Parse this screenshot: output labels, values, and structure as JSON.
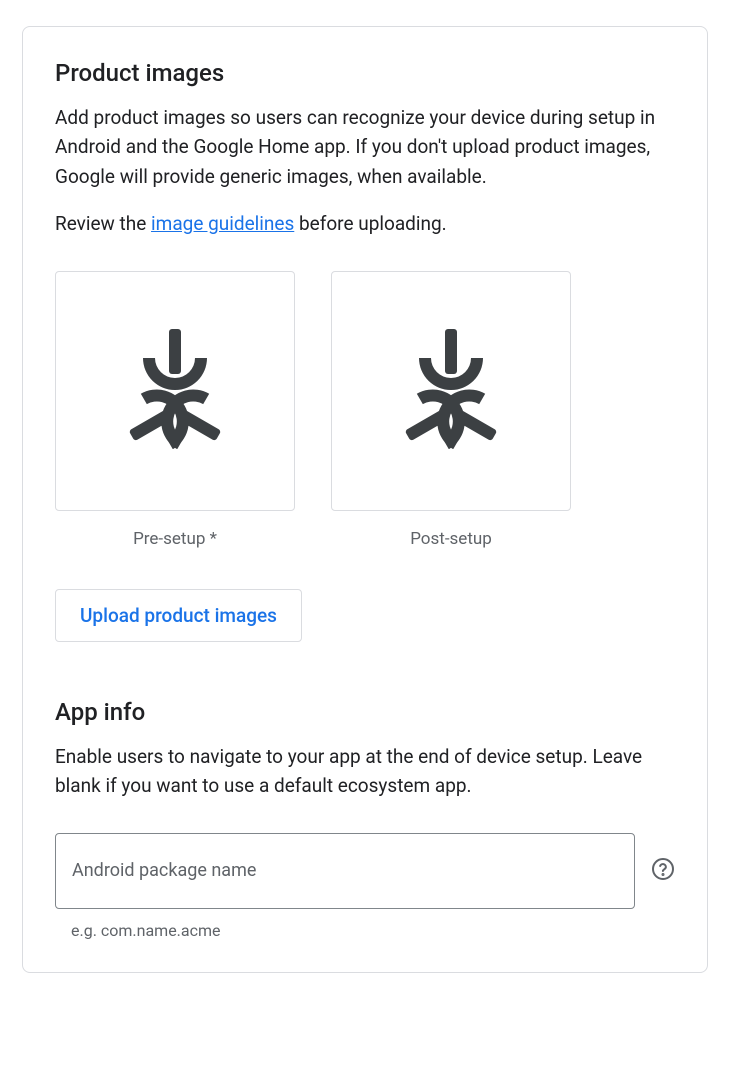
{
  "productImages": {
    "heading": "Product images",
    "description": "Add product images so users can recognize your device during setup in Android and the Google Home app. If you don't upload product images, Google will provide generic images, when available.",
    "reviewPrefix": "Review the ",
    "guidelinesLink": "image guidelines",
    "reviewSuffix": " before uploading.",
    "items": [
      {
        "caption": "Pre-setup *"
      },
      {
        "caption": "Post-setup"
      }
    ],
    "uploadButton": "Upload product images"
  },
  "appInfo": {
    "heading": "App info",
    "description": "Enable users to navigate to your app at the end of device setup. Leave blank if you want to use a default ecosystem app.",
    "packageField": {
      "placeholder": "Android package name",
      "value": "",
      "helper": "e.g. com.name.acme"
    }
  }
}
